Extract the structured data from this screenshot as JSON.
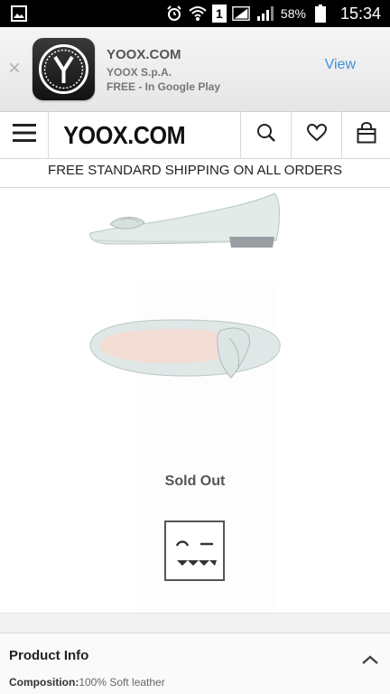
{
  "status_bar": {
    "battery_percent": "58%",
    "time": "15:34",
    "sim_slot": "1"
  },
  "app_banner": {
    "app_name": "YOOX.COM",
    "company": "YOOX S.p.A.",
    "store_text": "FREE - In Google Play",
    "view_label": "View",
    "close_symbol": "×"
  },
  "header": {
    "logo_text": "YOOX.COM"
  },
  "shipping_banner": "FREE STANDARD SHIPPING ON ALL ORDERS",
  "product": {
    "availability": "Sold Out"
  },
  "product_info": {
    "title": "Product Info",
    "composition_label": "Composition:",
    "composition_value": "100% Soft leather"
  },
  "colors": {
    "accent": "#3d8fe0",
    "shoe": "#dfe8e6",
    "shoe_lining": "#f3ddd5"
  }
}
